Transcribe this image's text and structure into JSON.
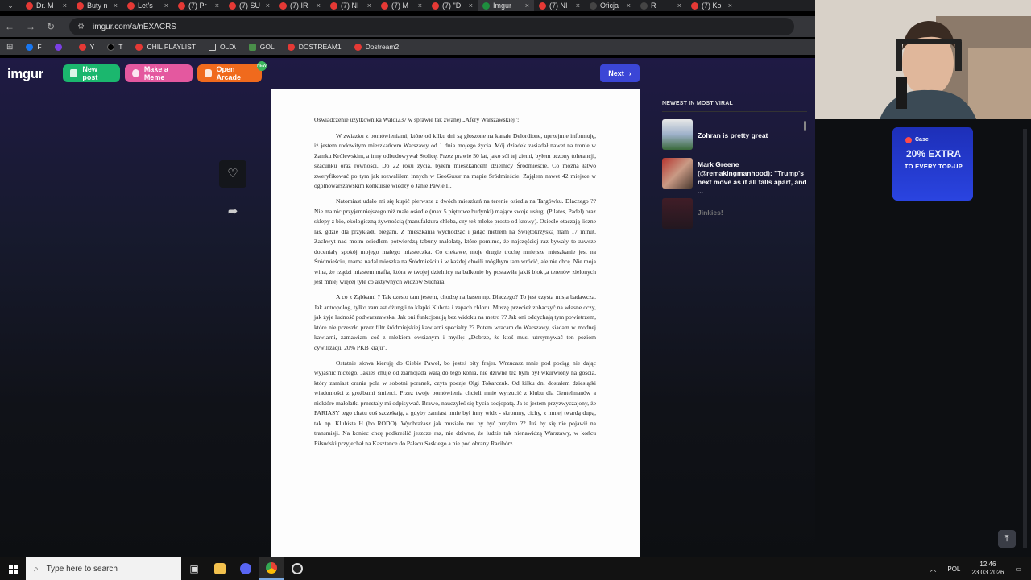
{
  "browser": {
    "tabs": [
      {
        "label": "Dr. M",
        "active": false,
        "icon": "youtube-icon"
      },
      {
        "label": "Buty n",
        "active": false,
        "icon": "youtube-icon"
      },
      {
        "label": "Let's",
        "active": false,
        "icon": "tiktok-icon"
      },
      {
        "label": "(7) Pr",
        "active": false,
        "icon": "youtube-icon"
      },
      {
        "label": "(7) SU",
        "active": false,
        "icon": "youtube-icon"
      },
      {
        "label": "(7) IR",
        "active": false,
        "icon": "youtube-icon"
      },
      {
        "label": "(7) NI",
        "active": false,
        "icon": "youtube-icon"
      },
      {
        "label": "(7) M",
        "active": false,
        "icon": "youtube-icon"
      },
      {
        "label": "(7) \"D",
        "active": false,
        "icon": "youtube-icon"
      },
      {
        "label": "Imgur",
        "active": true,
        "icon": "imgur-icon"
      },
      {
        "label": "(7) NI",
        "active": false,
        "icon": "youtube-icon"
      },
      {
        "label": "Oficja",
        "active": false,
        "icon": "x-icon"
      },
      {
        "label": "R",
        "active": false,
        "icon": "x-icon"
      },
      {
        "label": "(7) Ko",
        "active": false,
        "icon": "youtube-icon"
      }
    ],
    "url": "imgur.com/a/nEXACRS",
    "bookmarks": [
      {
        "label": "F",
        "icon": "facebook-icon"
      },
      {
        "label": "",
        "icon": "twitch-icon"
      },
      {
        "label": "Y",
        "icon": "youtube-icon"
      },
      {
        "label": "T",
        "icon": "x-icon"
      },
      {
        "label": "CHIL PLAYLIST",
        "icon": "youtube-icon"
      },
      {
        "label": "OLD\\",
        "icon": "folder-icon"
      },
      {
        "label": "GOL",
        "icon": "gol-icon"
      },
      {
        "label": "DOSTREAM1",
        "icon": "youtube-icon"
      },
      {
        "label": "Dostream2",
        "icon": "youtube-icon"
      }
    ]
  },
  "imgur": {
    "logo": "imgur",
    "new_post": "New post",
    "make_meme": "Make a Meme",
    "open_arcade": "Open Arcade",
    "arcade_badge": "NEW",
    "next": "Next",
    "sidebar_heading": "NEWEST IN MOST VIRAL",
    "viral": [
      {
        "title": "Zohran is pretty great",
        "dim": false
      },
      {
        "title": "Mark Greene (@remakingmanhood): \"Trump's next move as it all falls apart, and ...",
        "dim": false
      },
      {
        "title": "Jinkies!",
        "dim": true
      }
    ]
  },
  "document": {
    "title": "Oświadczenie użytkownika Waldi237 w sprawie tak zwanej „Afery Warszawskiej\":",
    "paragraphs": [
      "W związku z pomówieniami, które od kilku dni są głoszone na kanale Delordione, uprzejmie informuję, iż jestem rodowitym mieszkańcem Warszawy od 1 dnia mojego życia. Mój dziadek zasiadał nawet na tronie w Zamku Królewskim, a inny odbudowywał Stolicę. Przez prawie 50 lat, jako sól tej ziemi, byłem uczony tolerancji, szacunku oraz równości. Do 22 roku życia, byłem mieszkańcem dzielnicy Śródmieście. Co można łatwo zweryfikować po tym jak rozwaliłem innych w GeoGussr na mapie Śródmieście. Zająłem nawet 42 miejsce w ogólnowarszawskim konkursie wiedzy o Janie Pawle II.",
      "Natomiast udało mi się kupić pierwsze z dwóch mieszkań na terenie osiedla na Targówku. Dlaczego ?? Nie ma nic przyjemniejszego niż małe osiedle (max 5 piętrowe budynki) mające swoje usługi (Pilates, Padel) oraz sklepy z bio, ekologiczną żywnością (manufaktura chleba, czy też mleko prosto od krowy). Osiedle otaczają liczne las, gdzie dla przykładu biegam. Z mieszkania wychodząc i jadąc metrem na Świętokrzyską mam 17 minut. Zachwyt nad moim osiedlem potwierdzą tabuny małolatę, które pomimo, że najczęściej raz bywały to zawsze doceniały spokój mojego małego miasteczka. Co ciekawe, moje drugie trochę mniejsze mieszkanie jest na Śródmieściu, mama nadal mieszka na Śródmieściu i w każdej chwili mógłbym tam wrócić, ale nie chcę. Nie moja wina, że rządzi miastem mafia, która w twojej dzielnicy na balkonie by postawiła jakiś blok ,a terenów zielonych jest mniej więcej tyle co aktywnych widzów Suchara.",
      "A co z Ząbkami ? Tak często tam jestem, chodzę na basen np. Dlaczego? To jest czysta misja badawcza. Jak antropolog, tylko zamiast dżungli to klapki Kubota i zapach chloru. Muszę przecież zobaczyć na własne oczy, jak żyje ludność podwarszawska. Jak oni funkcjonują bez widoku na metro ?? Jak oni oddychają tym powietrzem, które nie przeszło przez filtr śródmiejskiej kawiarni specialty ?? Potem wracam do Warszawy, siadam w modnej kawiarni, zamawiam coś z mlekiem owsianym i myślę: „Dobrze, że ktoś musi utrzymywać ten poziom cywilizacji, 20% PKB kraju\".",
      "Ostatnie słowa kieruję do Ciebie Paweł, bo jesteś bity frajer. Wrzucasz mnie pod pociąg nie dając wyjaśnić niczego. Jakieś chuje od ziarnojada walą do tego konia, nie dziwne też bym był wkurwiony na gościa, który zamiast orania pola w sobotni poranek, czyta poezje Olgi Tokarczuk. Od kilku dni dostałem dziesiątki wiadomości z groźbami śmierci. Przez twoje pomówienia chcieli mnie wyrzucić z klubu dla Gentelmanów a niektóre małolatki przestały mi odpisywać. Brawo, nauczyłeś się bycia socjopatą. Ja to jestem przyzwyczajony, że PARIASY tego chatu coś szczekają, a gdyby zamiast mnie był inny widz - skromny, cichy, z mniej twardą dupą, tak np. Klubista H (bo RODO). Wyobrażasz jak musiało mu by być przykro ?? Już by się nie pojawił na transmisji. Na koniec chcę podkreślić jeszcze raz, nie dziwne, że ludzie tak nienawidzą Warszawy, w końcu Piłsudski przyjechał na Kasztance do Pałacu Saskiego a nie pod obrany Racibórz."
    ]
  },
  "ad": {
    "brand": "Case",
    "main": "20% EXTRA",
    "sub": "TO EVERY TOP-UP"
  },
  "taskbar": {
    "search_placeholder": "Type here to search",
    "lang": "POL",
    "time": "12:46",
    "date": "23.03.2026"
  },
  "colors": {
    "new_post": "#1bb76e",
    "make_meme": "#e4589f",
    "open_arcade": "#f06a1d",
    "next": "#3b46d6",
    "ad_bg": "#2a44e0"
  }
}
